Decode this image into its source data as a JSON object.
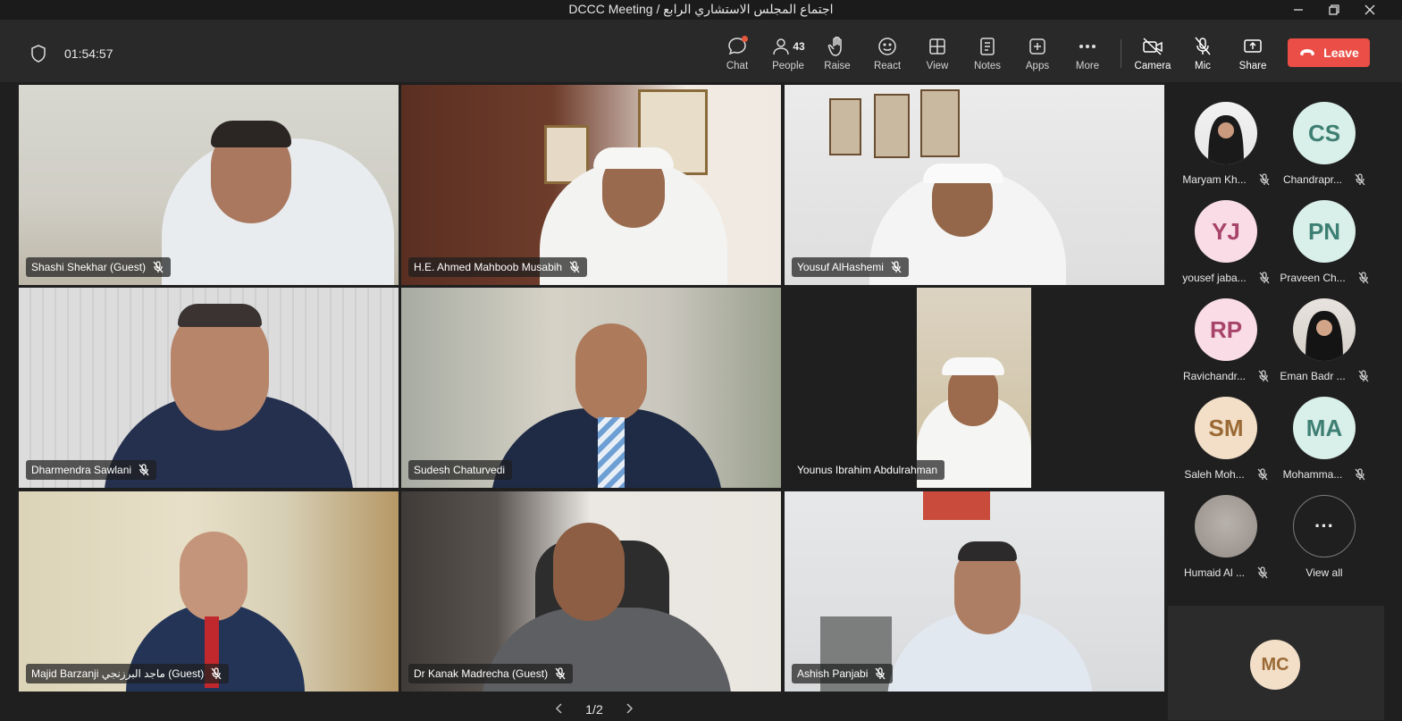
{
  "window": {
    "title": "DCCC Meeting / اجتماع المجلس الاستشاري الرابع"
  },
  "toolbar": {
    "timer": "01:54:57",
    "chat": "Chat",
    "people": "People",
    "people_count": "43",
    "raise": "Raise",
    "react": "React",
    "view": "View",
    "notes": "Notes",
    "apps": "Apps",
    "more": "More",
    "camera": "Camera",
    "mic": "Mic",
    "share": "Share",
    "leave": "Leave"
  },
  "tiles": [
    {
      "name": "Shashi Shekhar (Guest)"
    },
    {
      "name": "H.E. Ahmed Mahboob Musabih"
    },
    {
      "name": "Yousuf AlHashemi"
    },
    {
      "name": "Dharmendra Sawlani"
    },
    {
      "name": "Sudesh Chaturvedi"
    },
    {
      "name": "Younus Ibrahim Abdulrahman"
    },
    {
      "name": "Majid Barzanji ماجد البرزنجي (Guest)"
    },
    {
      "name": "Dr Kanak Madrecha (Guest)"
    },
    {
      "name": "Ashish Panjabi"
    }
  ],
  "roster": [
    {
      "name": "Maryam Kh...",
      "initials": ""
    },
    {
      "name": "Chandrapr...",
      "initials": "CS"
    },
    {
      "name": "yousef jaba...",
      "initials": "YJ"
    },
    {
      "name": "Praveen Ch...",
      "initials": "PN"
    },
    {
      "name": "Ravichandr...",
      "initials": "RP"
    },
    {
      "name": "Eman Badr ...",
      "initials": ""
    },
    {
      "name": "Saleh Moh...",
      "initials": "SM"
    },
    {
      "name": "Mohamma...",
      "initials": "MA"
    },
    {
      "name": "Humaid Al ...",
      "initials": ""
    }
  ],
  "view_all": {
    "label": "View all",
    "glyph": "···"
  },
  "self": {
    "initials": "MC"
  },
  "pager": {
    "label": "1/2"
  },
  "colors": {
    "leave": "#ea4e46",
    "accent_green": "#d9efe9",
    "accent_pink": "#f9dce6",
    "accent_peach": "#f3dfc7"
  }
}
